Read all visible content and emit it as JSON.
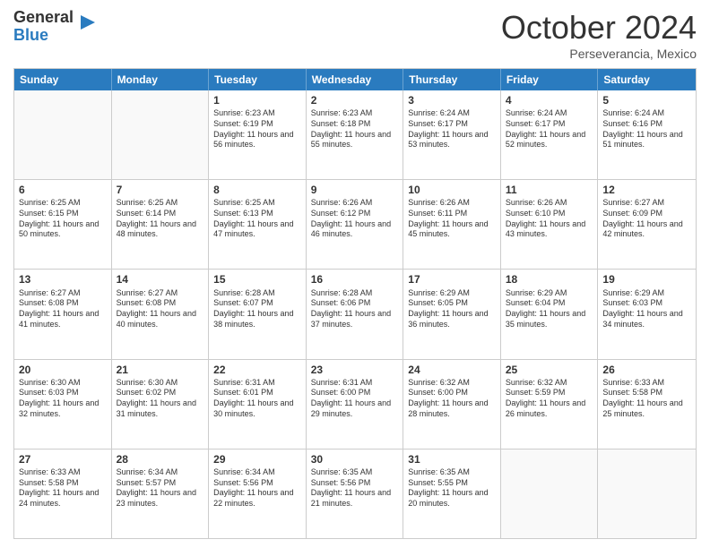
{
  "logo": {
    "general": "General",
    "blue": "Blue",
    "icon": "▶"
  },
  "title": "October 2024",
  "subtitle": "Perseverancia, Mexico",
  "header_days": [
    "Sunday",
    "Monday",
    "Tuesday",
    "Wednesday",
    "Thursday",
    "Friday",
    "Saturday"
  ],
  "weeks": [
    [
      {
        "day": "",
        "sunrise": "",
        "sunset": "",
        "daylight": "",
        "empty": true
      },
      {
        "day": "",
        "sunrise": "",
        "sunset": "",
        "daylight": "",
        "empty": true
      },
      {
        "day": "1",
        "sunrise": "Sunrise: 6:23 AM",
        "sunset": "Sunset: 6:19 PM",
        "daylight": "Daylight: 11 hours and 56 minutes."
      },
      {
        "day": "2",
        "sunrise": "Sunrise: 6:23 AM",
        "sunset": "Sunset: 6:18 PM",
        "daylight": "Daylight: 11 hours and 55 minutes."
      },
      {
        "day": "3",
        "sunrise": "Sunrise: 6:24 AM",
        "sunset": "Sunset: 6:17 PM",
        "daylight": "Daylight: 11 hours and 53 minutes."
      },
      {
        "day": "4",
        "sunrise": "Sunrise: 6:24 AM",
        "sunset": "Sunset: 6:17 PM",
        "daylight": "Daylight: 11 hours and 52 minutes."
      },
      {
        "day": "5",
        "sunrise": "Sunrise: 6:24 AM",
        "sunset": "Sunset: 6:16 PM",
        "daylight": "Daylight: 11 hours and 51 minutes."
      }
    ],
    [
      {
        "day": "6",
        "sunrise": "Sunrise: 6:25 AM",
        "sunset": "Sunset: 6:15 PM",
        "daylight": "Daylight: 11 hours and 50 minutes."
      },
      {
        "day": "7",
        "sunrise": "Sunrise: 6:25 AM",
        "sunset": "Sunset: 6:14 PM",
        "daylight": "Daylight: 11 hours and 48 minutes."
      },
      {
        "day": "8",
        "sunrise": "Sunrise: 6:25 AM",
        "sunset": "Sunset: 6:13 PM",
        "daylight": "Daylight: 11 hours and 47 minutes."
      },
      {
        "day": "9",
        "sunrise": "Sunrise: 6:26 AM",
        "sunset": "Sunset: 6:12 PM",
        "daylight": "Daylight: 11 hours and 46 minutes."
      },
      {
        "day": "10",
        "sunrise": "Sunrise: 6:26 AM",
        "sunset": "Sunset: 6:11 PM",
        "daylight": "Daylight: 11 hours and 45 minutes."
      },
      {
        "day": "11",
        "sunrise": "Sunrise: 6:26 AM",
        "sunset": "Sunset: 6:10 PM",
        "daylight": "Daylight: 11 hours and 43 minutes."
      },
      {
        "day": "12",
        "sunrise": "Sunrise: 6:27 AM",
        "sunset": "Sunset: 6:09 PM",
        "daylight": "Daylight: 11 hours and 42 minutes."
      }
    ],
    [
      {
        "day": "13",
        "sunrise": "Sunrise: 6:27 AM",
        "sunset": "Sunset: 6:08 PM",
        "daylight": "Daylight: 11 hours and 41 minutes."
      },
      {
        "day": "14",
        "sunrise": "Sunrise: 6:27 AM",
        "sunset": "Sunset: 6:08 PM",
        "daylight": "Daylight: 11 hours and 40 minutes."
      },
      {
        "day": "15",
        "sunrise": "Sunrise: 6:28 AM",
        "sunset": "Sunset: 6:07 PM",
        "daylight": "Daylight: 11 hours and 38 minutes."
      },
      {
        "day": "16",
        "sunrise": "Sunrise: 6:28 AM",
        "sunset": "Sunset: 6:06 PM",
        "daylight": "Daylight: 11 hours and 37 minutes."
      },
      {
        "day": "17",
        "sunrise": "Sunrise: 6:29 AM",
        "sunset": "Sunset: 6:05 PM",
        "daylight": "Daylight: 11 hours and 36 minutes."
      },
      {
        "day": "18",
        "sunrise": "Sunrise: 6:29 AM",
        "sunset": "Sunset: 6:04 PM",
        "daylight": "Daylight: 11 hours and 35 minutes."
      },
      {
        "day": "19",
        "sunrise": "Sunrise: 6:29 AM",
        "sunset": "Sunset: 6:03 PM",
        "daylight": "Daylight: 11 hours and 34 minutes."
      }
    ],
    [
      {
        "day": "20",
        "sunrise": "Sunrise: 6:30 AM",
        "sunset": "Sunset: 6:03 PM",
        "daylight": "Daylight: 11 hours and 32 minutes."
      },
      {
        "day": "21",
        "sunrise": "Sunrise: 6:30 AM",
        "sunset": "Sunset: 6:02 PM",
        "daylight": "Daylight: 11 hours and 31 minutes."
      },
      {
        "day": "22",
        "sunrise": "Sunrise: 6:31 AM",
        "sunset": "Sunset: 6:01 PM",
        "daylight": "Daylight: 11 hours and 30 minutes."
      },
      {
        "day": "23",
        "sunrise": "Sunrise: 6:31 AM",
        "sunset": "Sunset: 6:00 PM",
        "daylight": "Daylight: 11 hours and 29 minutes."
      },
      {
        "day": "24",
        "sunrise": "Sunrise: 6:32 AM",
        "sunset": "Sunset: 6:00 PM",
        "daylight": "Daylight: 11 hours and 28 minutes."
      },
      {
        "day": "25",
        "sunrise": "Sunrise: 6:32 AM",
        "sunset": "Sunset: 5:59 PM",
        "daylight": "Daylight: 11 hours and 26 minutes."
      },
      {
        "day": "26",
        "sunrise": "Sunrise: 6:33 AM",
        "sunset": "Sunset: 5:58 PM",
        "daylight": "Daylight: 11 hours and 25 minutes."
      }
    ],
    [
      {
        "day": "27",
        "sunrise": "Sunrise: 6:33 AM",
        "sunset": "Sunset: 5:58 PM",
        "daylight": "Daylight: 11 hours and 24 minutes."
      },
      {
        "day": "28",
        "sunrise": "Sunrise: 6:34 AM",
        "sunset": "Sunset: 5:57 PM",
        "daylight": "Daylight: 11 hours and 23 minutes."
      },
      {
        "day": "29",
        "sunrise": "Sunrise: 6:34 AM",
        "sunset": "Sunset: 5:56 PM",
        "daylight": "Daylight: 11 hours and 22 minutes."
      },
      {
        "day": "30",
        "sunrise": "Sunrise: 6:35 AM",
        "sunset": "Sunset: 5:56 PM",
        "daylight": "Daylight: 11 hours and 21 minutes."
      },
      {
        "day": "31",
        "sunrise": "Sunrise: 6:35 AM",
        "sunset": "Sunset: 5:55 PM",
        "daylight": "Daylight: 11 hours and 20 minutes."
      },
      {
        "day": "",
        "sunrise": "",
        "sunset": "",
        "daylight": "",
        "empty": true
      },
      {
        "day": "",
        "sunrise": "",
        "sunset": "",
        "daylight": "",
        "empty": true
      }
    ]
  ]
}
